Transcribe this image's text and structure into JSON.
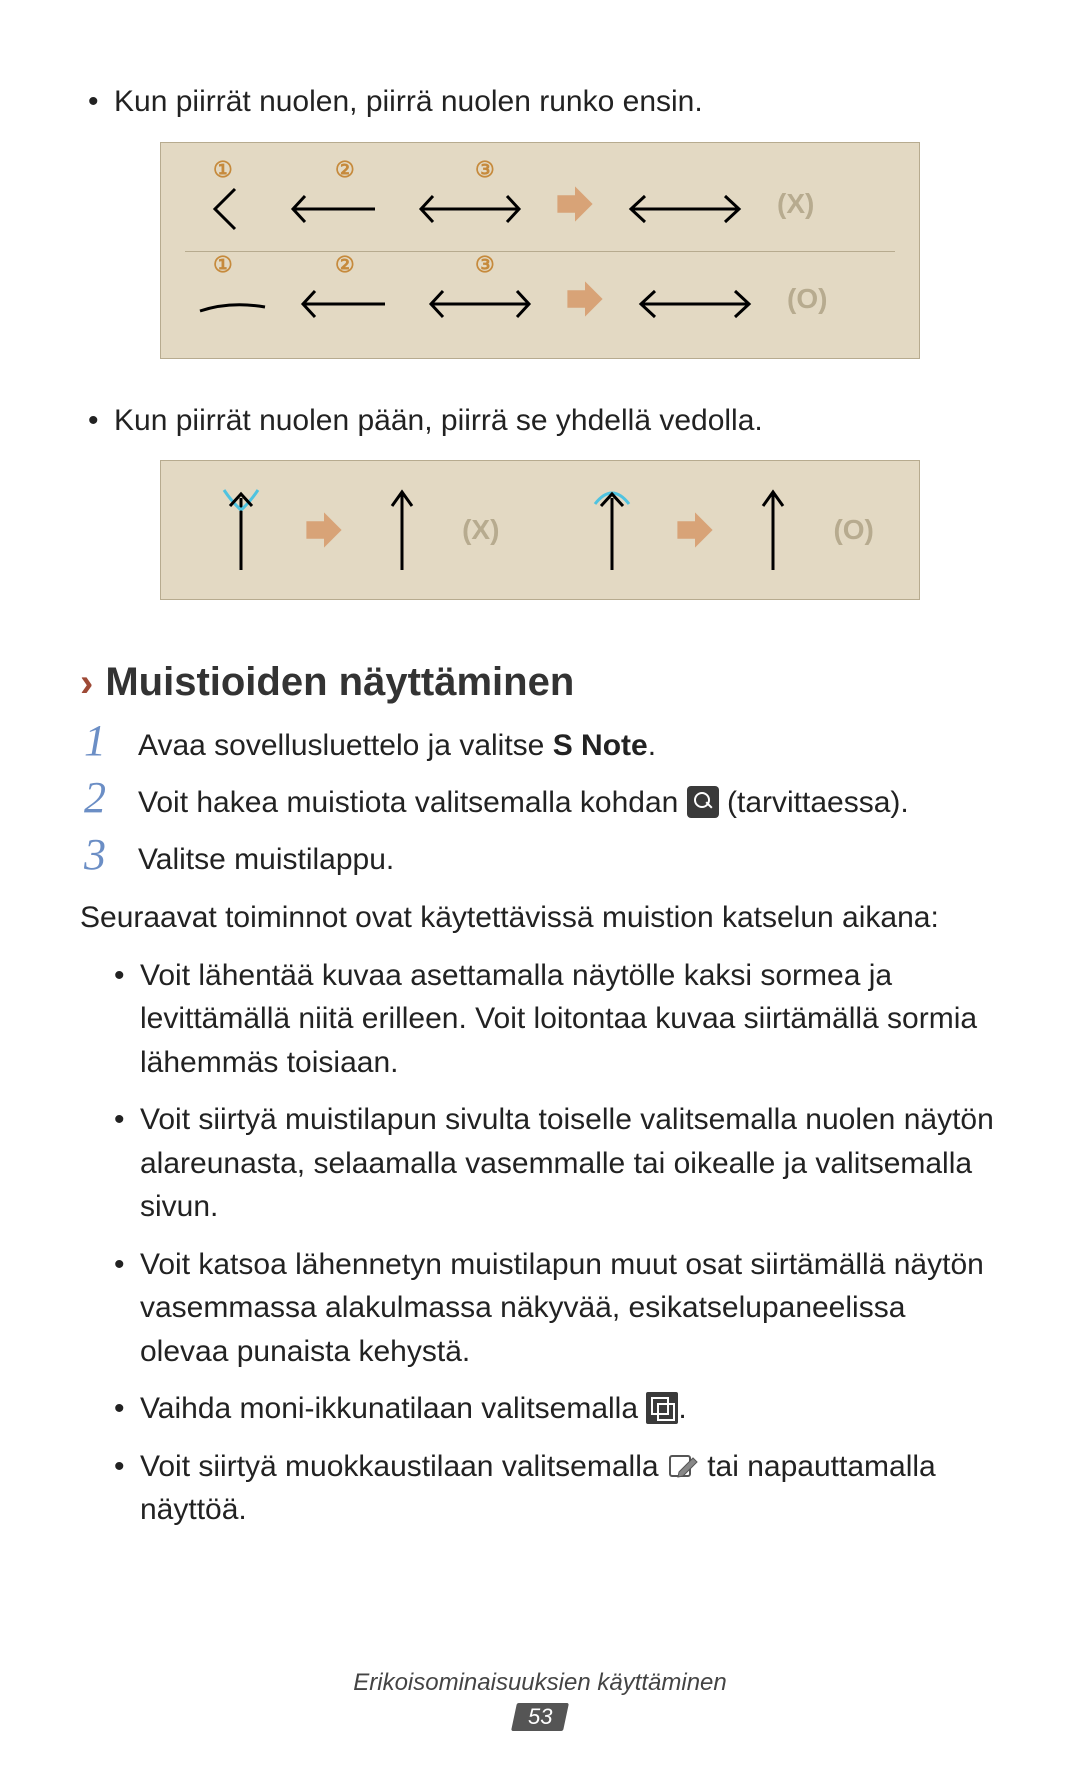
{
  "bullets_top": {
    "b1": "Kun piirrät nuolen, piirrä nuolen runko ensin.",
    "b2": "Kun piirrät nuolen pään, piirrä se yhdellä vedolla."
  },
  "diagram1": {
    "steps": {
      "s1": "①",
      "s2": "②",
      "s3": "③"
    },
    "result_x": "(X)",
    "result_o": "(O)"
  },
  "diagram2": {
    "result_x": "(X)",
    "result_o": "(O)"
  },
  "section": {
    "heading": "Muistioiden näyttäminen"
  },
  "steps": {
    "n1": "1",
    "t1_pre": "Avaa sovellusluettelo ja valitse ",
    "t1_bold": "S Note",
    "t1_post": ".",
    "n2": "2",
    "t2_pre": "Voit hakea muistiota valitsemalla kohdan ",
    "t2_post": " (tarvittaessa).",
    "n3": "3",
    "t3": "Valitse muistilappu."
  },
  "para_intro": "Seuraavat toiminnot ovat käytettävissä muistion katselun aikana:",
  "bullets_main": {
    "b1": "Voit lähentää kuvaa asettamalla näytölle kaksi sormea ja levittämällä niitä erilleen. Voit loitontaa kuvaa siirtämällä sormia lähemmäs toisiaan.",
    "b2": "Voit siirtyä muistilapun sivulta toiselle valitsemalla nuolen näytön alareunasta, selaamalla vasemmalle tai oikealle ja valitsemalla sivun.",
    "b3": "Voit katsoa lähennetyn muistilapun muut osat siirtämällä näytön vasemmassa alakulmassa näkyvää, esikatselupaneelissa olevaa punaista kehystä.",
    "b4_pre": "Vaihda moni-ikkunatilaan valitsemalla ",
    "b4_post": ".",
    "b5_pre": "Voit siirtyä muokkaustilaan valitsemalla ",
    "b5_post": " tai napauttamalla näyttöä."
  },
  "footer": {
    "section_title": "Erikoisominaisuuksien käyttäminen",
    "page_number": "53"
  }
}
